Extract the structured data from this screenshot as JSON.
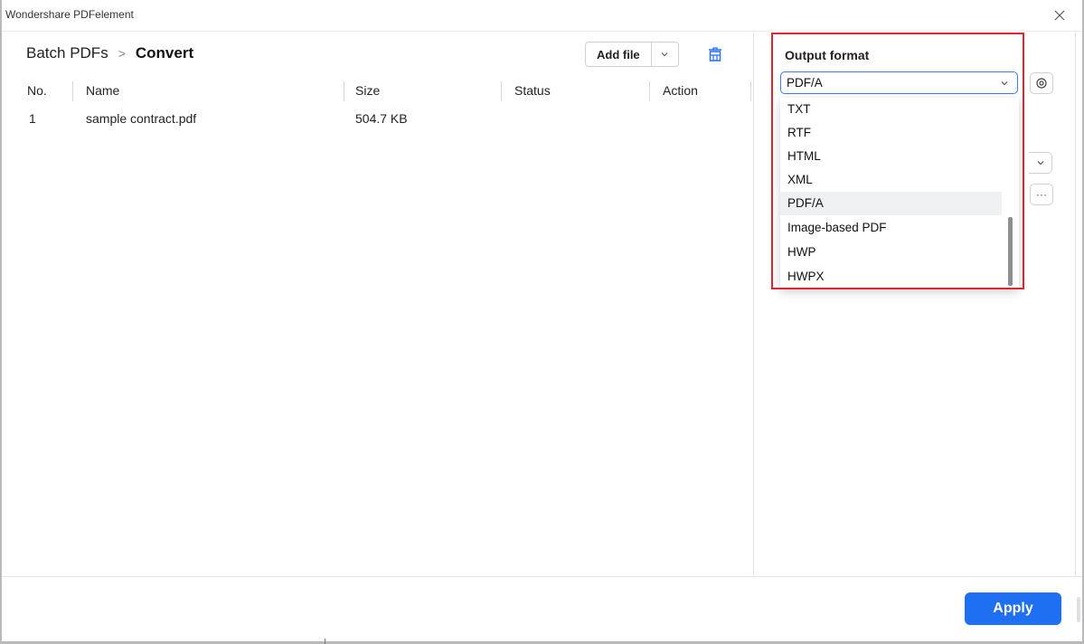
{
  "window": {
    "title": "Wondershare PDFelement"
  },
  "breadcrumb": {
    "root": "Batch PDFs",
    "separator": ">",
    "current": "Convert"
  },
  "toolbar": {
    "add_file_label": "Add file"
  },
  "table": {
    "headers": [
      "No.",
      "Name",
      "Size",
      "Status",
      "Action"
    ],
    "rows": [
      {
        "no": "1",
        "name": "sample contract.pdf",
        "size": "504.7 KB",
        "status": "",
        "action": ""
      }
    ]
  },
  "output": {
    "label": "Output format",
    "selected": "PDF/A",
    "options": [
      "TXT",
      "RTF",
      "HTML",
      "XML",
      "PDF/A",
      "Image-based PDF",
      "HWP",
      "HWPX"
    ],
    "more_label": "···"
  },
  "footer": {
    "apply_label": "Apply"
  },
  "colors": {
    "accent": "#1f6ff2",
    "highlight": "#e0252d",
    "select_border": "#3b7df5"
  },
  "icons": [
    "close-icon",
    "chevron-down-icon",
    "trash-icon",
    "gear-icon",
    "more-icon"
  ]
}
